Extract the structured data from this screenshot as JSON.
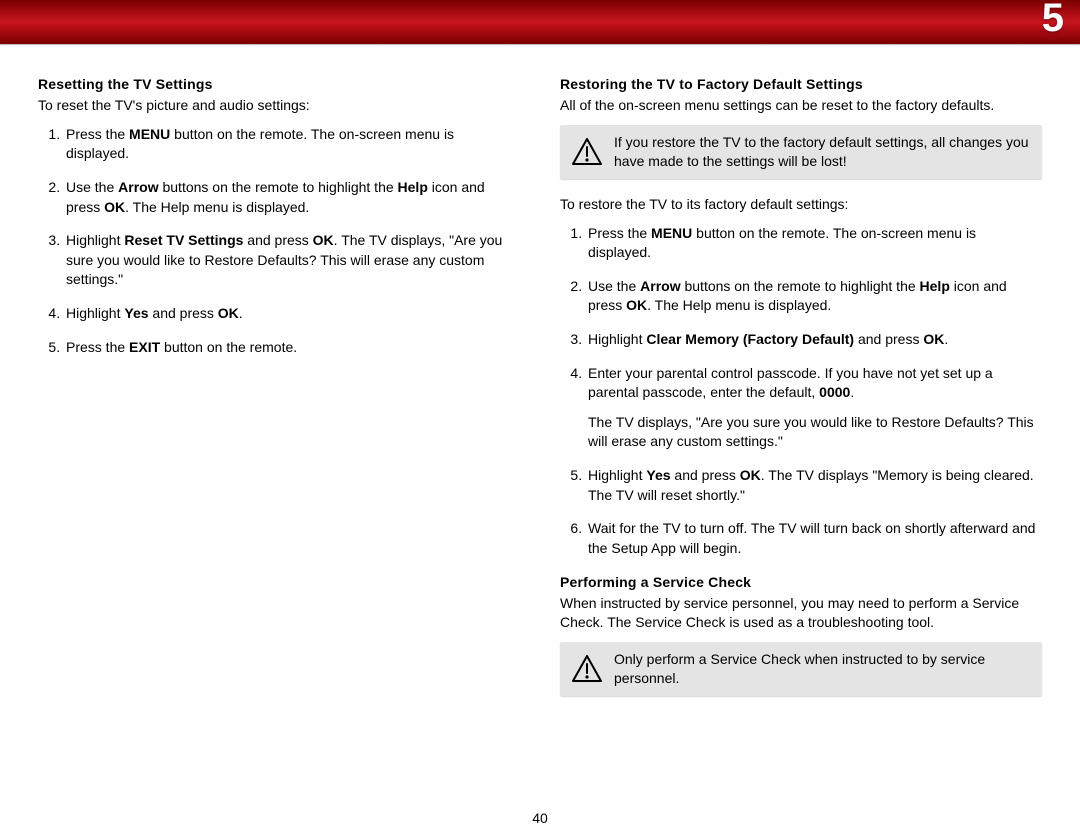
{
  "chapter": "5",
  "page_number": "40",
  "left": {
    "h1": "Resetting the TV Settings",
    "intro": "To reset the TV's picture and audio settings:",
    "steps": [
      "Press the <b>MENU</b> button on the remote. The on-screen menu is displayed.",
      "Use the <b>Arrow</b> buttons on the remote to highlight the <b>Help</b> icon and press <b>OK</b>. The Help menu is displayed.",
      "Highlight <b>Reset TV Settings</b> and press <b>OK</b>. The TV displays, \"Are you sure you would like to Restore Defaults? This will erase any custom settings.\"",
      "Highlight <b>Yes</b> and press <b>OK</b>.",
      "Press the <b>EXIT</b> button on the remote."
    ]
  },
  "right": {
    "h1": "Restoring the TV to Factory Default Settings",
    "intro": "All of the on-screen menu settings can be reset to the factory defaults.",
    "warning1": "If you restore the TV to the factory default settings, all changes you have made to the settings will be lost!",
    "intro2": "To restore the TV to its factory default settings:",
    "steps": [
      "Press the <b>MENU</b> button on the remote. The on-screen menu is displayed.",
      "Use the <b>Arrow</b> buttons on the remote to highlight the <b>Help</b> icon and press <b>OK</b>. The Help menu is displayed.",
      "Highlight <b>Clear Memory (Factory Default)</b> and press <b>OK</b>.",
      "Enter your parental control passcode. If you have not yet set up a parental passcode, enter the default, <b>0000</b>.<span class=\"sub\">The TV displays, \"Are you sure you would like to Restore Defaults? This will erase any custom settings.\"</span>",
      "Highlight <b>Yes</b> and press <b>OK</b>. The TV displays \"Memory is being cleared. The TV will reset shortly.\"",
      "Wait for the TV to turn off. The TV will turn back on shortly afterward and the Setup App will begin."
    ],
    "h2": "Performing a Service Check",
    "sc_intro": "When instructed by service personnel, you may need to perform a Service Check. The Service Check is used as a troubleshooting tool.",
    "warning2": "Only perform a Service Check when instructed to by service personnel."
  }
}
